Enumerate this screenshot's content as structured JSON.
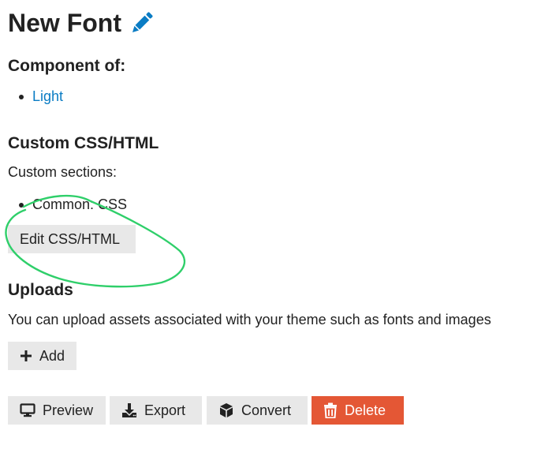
{
  "header": {
    "title": "New Font",
    "edit_icon": "pencil-icon",
    "accent_color": "#0a7cc4"
  },
  "component_of": {
    "heading": "Component of:",
    "items": [
      {
        "label": "Light"
      }
    ]
  },
  "custom_css": {
    "heading": "Custom CSS/HTML",
    "sections_label": "Custom sections:",
    "sections": [
      {
        "label": "Common: CSS"
      }
    ],
    "edit_button_label": "Edit CSS/HTML"
  },
  "uploads": {
    "heading": "Uploads",
    "description": "You can upload assets associated with your theme such as fonts and images",
    "add_button_label": "Add",
    "add_icon": "plus-icon"
  },
  "actions": {
    "preview_label": "Preview",
    "preview_icon": "desktop-icon",
    "export_label": "Export",
    "export_icon": "download-icon",
    "convert_label": "Convert",
    "convert_icon": "cube-icon",
    "delete_label": "Delete",
    "delete_icon": "trash-icon",
    "delete_color": "#e45735"
  },
  "annotation": {
    "shape": "hand-drawn ellipse around edit css/html button",
    "color": "#2fcf6a"
  }
}
